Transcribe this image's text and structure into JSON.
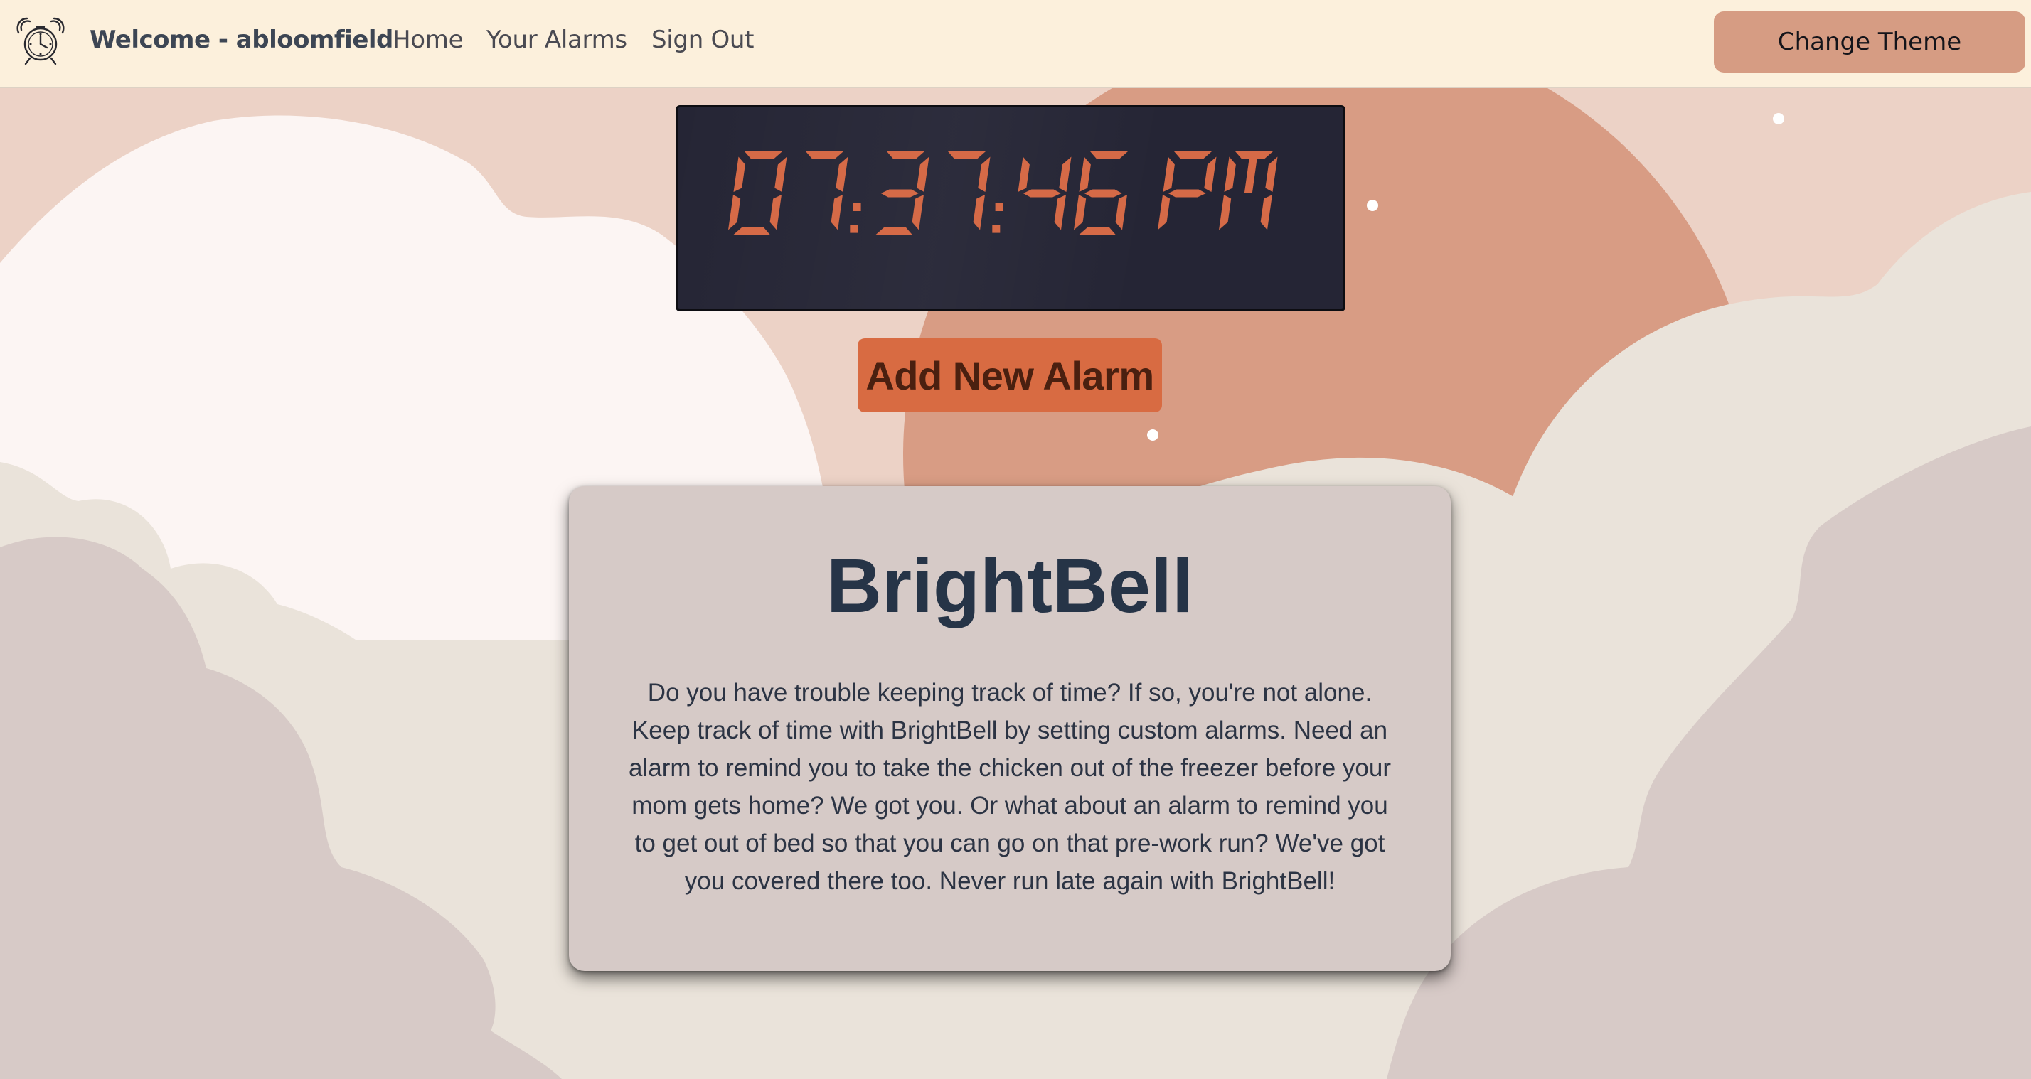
{
  "navbar": {
    "logo_icon": "alarm-clock-icon",
    "welcome": "Welcome - abloomfield",
    "links": [
      "Home",
      "Your Alarms",
      "Sign Out"
    ],
    "theme_button": "Change Theme"
  },
  "clock": {
    "time": "07:37:46 PM",
    "digit_color": "#d56a47",
    "background": "#252535"
  },
  "add_alarm": {
    "label": "Add New Alarm"
  },
  "card": {
    "title": "BrightBell",
    "body": "Do you have trouble keeping track of time? If so, you're not alone. Keep track of time with BrightBell by setting custom alarms. Need an alarm to remind you to take the chicken out of the freezer before your mom gets home? We got you. Or what about an alarm to remind you to get out of bed so that you can go on that pre-work run? We've got you covered there too. Never run late again with BrightBell!"
  },
  "colors": {
    "navbar_bg": "#fcf0dc",
    "theme_button": "#d69c83",
    "accent": "#d86b42",
    "card_bg": "#d6cac7",
    "title": "#263447"
  }
}
